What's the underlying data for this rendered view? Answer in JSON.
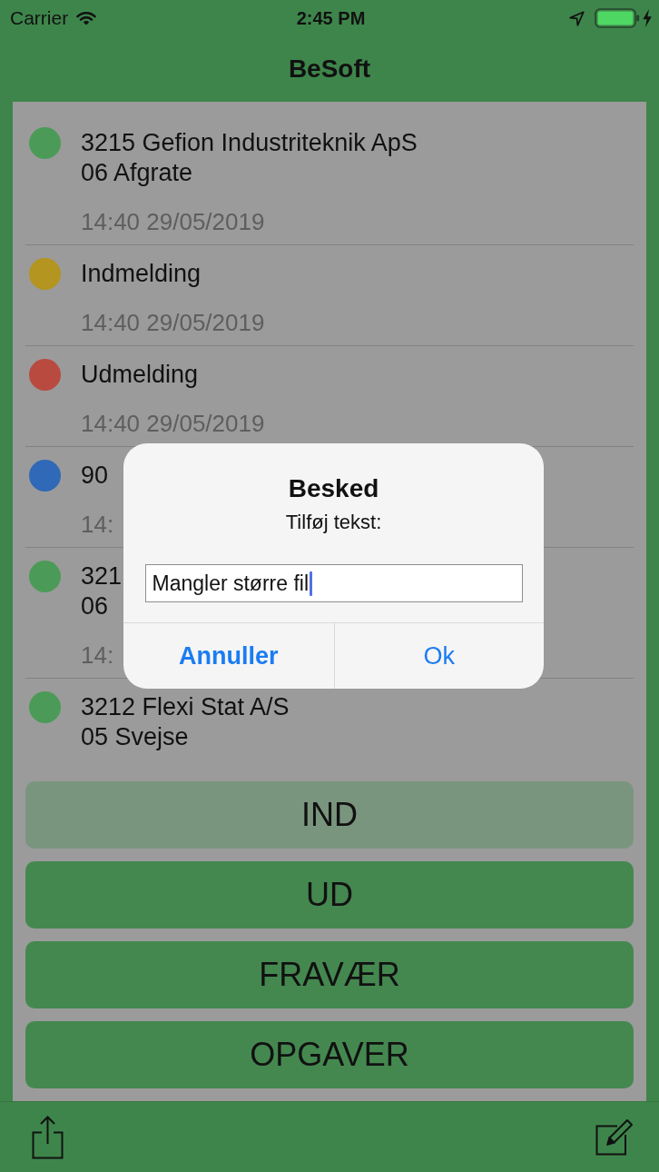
{
  "status_bar": {
    "carrier": "Carrier",
    "time": "2:45 PM"
  },
  "nav_bar": {
    "title": "BeSoft"
  },
  "list": [
    {
      "color": "#4c9a58",
      "lines": [
        "3215 Gefion Industriteknik ApS",
        "06 Afgrate"
      ],
      "timestamp": "14:40 29/05/2019"
    },
    {
      "color": "#b3951f",
      "lines": [
        "Indmelding"
      ],
      "timestamp": "14:40 29/05/2019"
    },
    {
      "color": "#b84a40",
      "lines": [
        "Udmelding"
      ],
      "timestamp": "14:40 29/05/2019"
    },
    {
      "color": "#2f69b8",
      "lines": [
        "90"
      ],
      "timestamp": "14:"
    },
    {
      "color": "#4c9a58",
      "lines": [
        "321",
        "06"
      ],
      "timestamp": "14:"
    },
    {
      "color": "#4c9a58",
      "lines": [
        "3212 Flexi Stat A/S",
        "05 Svejse"
      ]
    }
  ],
  "actions": [
    {
      "label": "IND",
      "disabled": true
    },
    {
      "label": "UD",
      "disabled": false
    },
    {
      "label": "FRAVÆR",
      "disabled": false
    },
    {
      "label": "OPGAVER",
      "disabled": false
    }
  ],
  "dialog": {
    "title": "Besked",
    "message": "Tilføj tekst:",
    "field": {
      "value": "Mangler større fil",
      "focused": true
    },
    "buttons": [
      {
        "label": "Annuller",
        "kind": "cancel"
      },
      {
        "label": "Ok",
        "kind": "default"
      }
    ]
  }
}
